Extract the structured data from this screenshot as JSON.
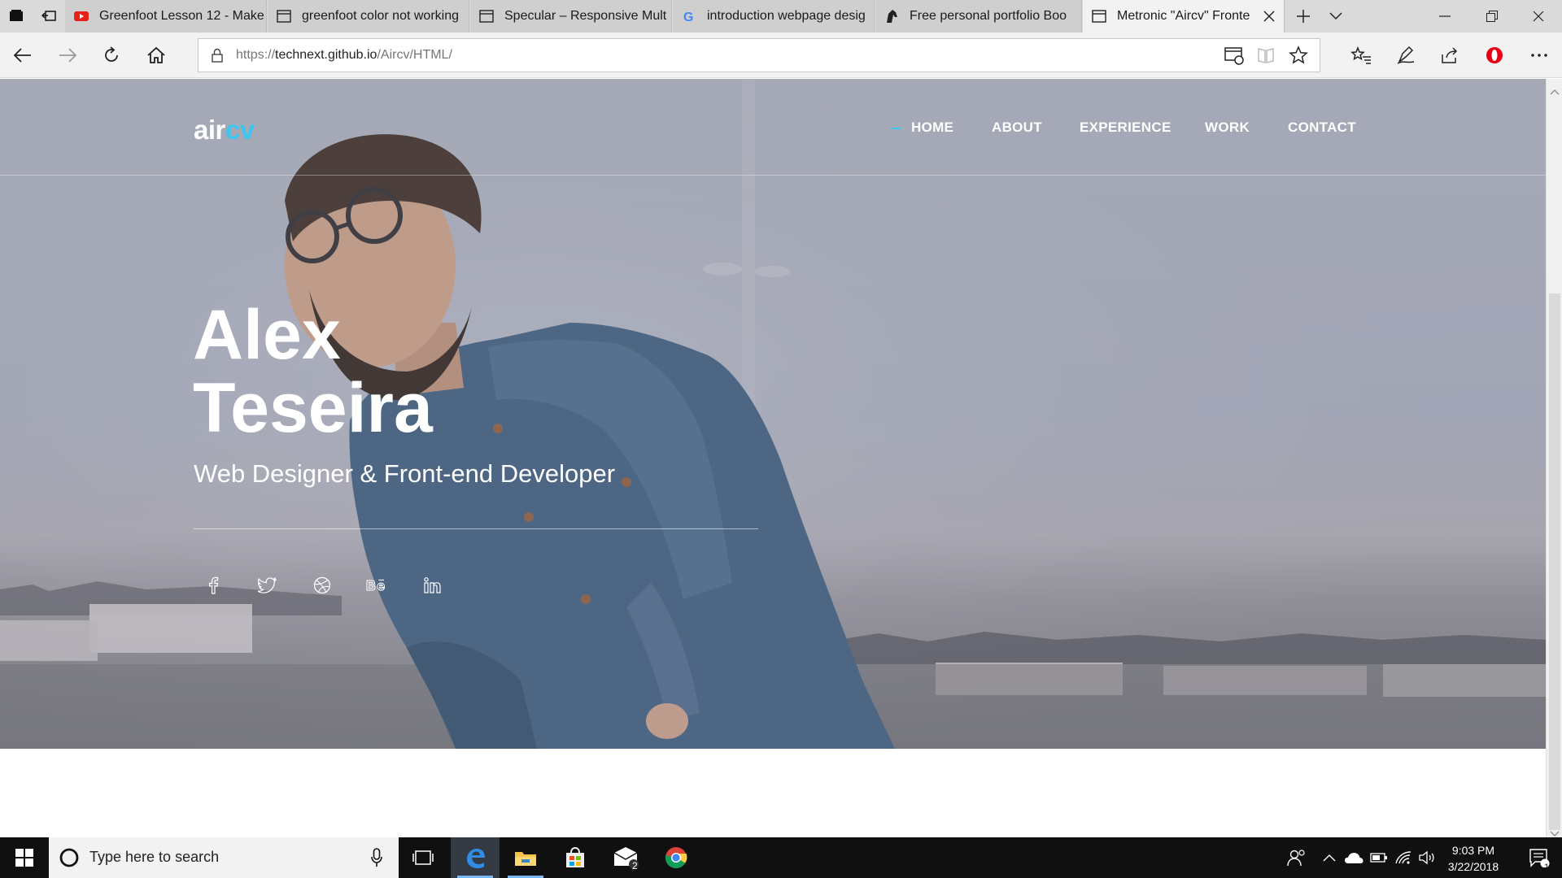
{
  "browser": {
    "tabs": [
      {
        "title": "Greenfoot Lesson 12 - Make",
        "favicon": "youtube-icon",
        "active": false
      },
      {
        "title": "greenfoot color not working",
        "favicon": "page-icon",
        "active": false
      },
      {
        "title": "Specular – Responsive Mult",
        "favicon": "page-icon",
        "active": false
      },
      {
        "title": "introduction webpage desig",
        "favicon": "google-icon",
        "active": false
      },
      {
        "title": "Free personal portfolio Boo",
        "favicon": "horse-icon",
        "active": false
      },
      {
        "title": "Metronic \"Aircv\" Fronte",
        "favicon": "page-icon",
        "active": true
      }
    ],
    "url": {
      "scheme": "https://",
      "host": "technext.github.io",
      "path": "/Aircv/HTML/"
    }
  },
  "site": {
    "logo": {
      "part1": "air",
      "part2": "cv"
    },
    "nav": [
      "HOME",
      "ABOUT",
      "EXPERIENCE",
      "WORK",
      "CONTACT"
    ],
    "active_nav": "HOME",
    "hero": {
      "first_name": "Alex",
      "last_name": "Teseira",
      "role": "Web Designer & Front-end Developer"
    },
    "social": [
      "facebook-icon",
      "twitter-icon",
      "dribbble-icon",
      "behance-icon",
      "linkedin-icon"
    ],
    "accent_color": "#3ec6f0"
  },
  "taskbar": {
    "search_placeholder": "Type here to search",
    "time": "9:03 PM",
    "date": "3/22/2018",
    "mail_badge": "2",
    "notification_count": "1"
  }
}
